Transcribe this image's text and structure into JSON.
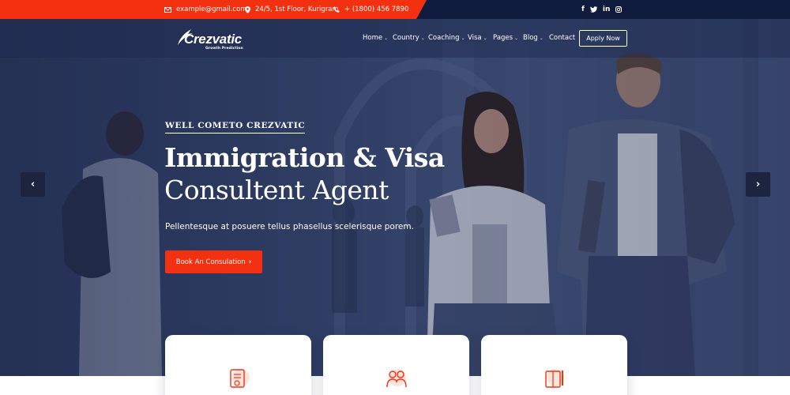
{
  "topbar": {
    "email": "example@gmail.com",
    "address": "24/5, 1st Floor, Kurigram",
    "phone": "+ (1800) 456 7890",
    "social": [
      {
        "icon": "facebook-icon",
        "glyph": "f"
      },
      {
        "icon": "twitter-icon",
        "glyph": "t"
      },
      {
        "icon": "linkedin-icon",
        "glyph": "in"
      },
      {
        "icon": "instagram-icon",
        "glyph": "o"
      }
    ]
  },
  "brand": {
    "name": "Crezvatic",
    "tagline": "Growth Prediction"
  },
  "nav": {
    "items": [
      {
        "label": "Home",
        "dropdown": true
      },
      {
        "label": "Country",
        "dropdown": true
      },
      {
        "label": "Coaching",
        "dropdown": true
      },
      {
        "label": "Visa",
        "dropdown": true
      },
      {
        "label": "Pages",
        "dropdown": true
      },
      {
        "label": "Blog",
        "dropdown": true
      },
      {
        "label": "Contact",
        "dropdown": false
      }
    ],
    "apply_label": "Apply Now"
  },
  "hero": {
    "eyebrow": "WELL COMETO CREZVATIC",
    "title_line1": "Immigration & Visa",
    "title_line2": "Consultent Agent",
    "lead": "Pellentesque at posuere tellus phasellus scelerisque porem.",
    "cta_label": "Book An Consulation",
    "prev_icon": "chevron-left-icon",
    "next_icon": "chevron-right-icon"
  },
  "colors": {
    "accent": "#f3300f",
    "dark_navy": "#0f1b3d",
    "hero_tint": "#34436b"
  },
  "cards": [
    {
      "icon": "document-certificate-icon"
    },
    {
      "icon": "family-people-icon"
    },
    {
      "icon": "book-pencil-icon"
    }
  ]
}
